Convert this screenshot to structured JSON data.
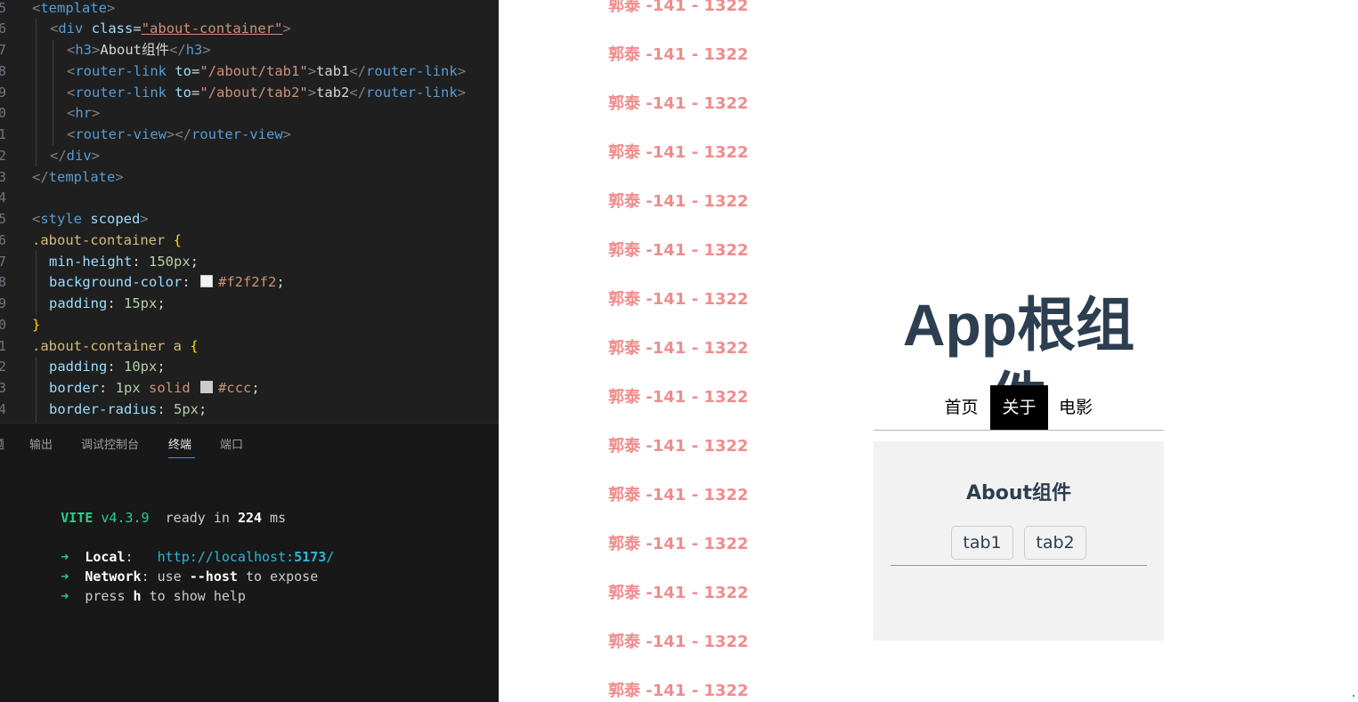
{
  "editor": {
    "lines": [
      {
        "n": "5",
        "tokens": [
          [
            "punct",
            "<"
          ],
          [
            "tag",
            "template"
          ],
          [
            "punct",
            ">"
          ]
        ]
      },
      {
        "n": "6",
        "tokens": [
          [
            "punct",
            "<"
          ],
          [
            "tag",
            "div"
          ],
          [
            "text",
            " "
          ],
          [
            "attr",
            "class"
          ],
          [
            "text",
            "="
          ],
          [
            "str",
            "\"about-container\""
          ],
          [
            "punct",
            ">"
          ]
        ]
      },
      {
        "n": "7",
        "tokens": [
          [
            "punct",
            "<"
          ],
          [
            "tag",
            "h3"
          ],
          [
            "punct",
            ">"
          ],
          [
            "text",
            "About组件"
          ],
          [
            "punct",
            "</"
          ],
          [
            "tag",
            "h3"
          ],
          [
            "punct",
            ">"
          ]
        ]
      },
      {
        "n": "8",
        "tokens": [
          [
            "punct",
            "<"
          ],
          [
            "tag",
            "router-link"
          ],
          [
            "text",
            " "
          ],
          [
            "attr",
            "to"
          ],
          [
            "text",
            "="
          ],
          [
            "str",
            "\"/about/tab1\""
          ],
          [
            "punct",
            ">"
          ],
          [
            "text",
            "tab1"
          ],
          [
            "punct",
            "</"
          ],
          [
            "tag",
            "router-link"
          ],
          [
            "punct",
            ">"
          ]
        ]
      },
      {
        "n": "9",
        "tokens": [
          [
            "punct",
            "<"
          ],
          [
            "tag",
            "router-link"
          ],
          [
            "text",
            " "
          ],
          [
            "attr",
            "to"
          ],
          [
            "text",
            "="
          ],
          [
            "str",
            "\"/about/tab2\""
          ],
          [
            "punct",
            ">"
          ],
          [
            "text",
            "tab2"
          ],
          [
            "punct",
            "</"
          ],
          [
            "tag",
            "router-link"
          ],
          [
            "punct",
            ">"
          ]
        ]
      },
      {
        "n": "0",
        "tokens": [
          [
            "punct",
            "<"
          ],
          [
            "tag",
            "hr"
          ],
          [
            "punct",
            ">"
          ]
        ]
      },
      {
        "n": "1",
        "tokens": [
          [
            "punct",
            "<"
          ],
          [
            "tag",
            "router-view"
          ],
          [
            "punct",
            "></"
          ],
          [
            "tag",
            "router-view"
          ],
          [
            "punct",
            ">"
          ]
        ]
      },
      {
        "n": "2",
        "tokens": [
          [
            "punct",
            "</"
          ],
          [
            "tag",
            "div"
          ],
          [
            "punct",
            ">"
          ]
        ]
      },
      {
        "n": "3",
        "tokens": [
          [
            "punct",
            "</"
          ],
          [
            "tag",
            "template"
          ],
          [
            "punct",
            ">"
          ]
        ]
      },
      {
        "n": "4",
        "tokens": []
      },
      {
        "n": "5",
        "tokens": [
          [
            "punct",
            "<"
          ],
          [
            "tag",
            "style"
          ],
          [
            "text",
            " "
          ],
          [
            "attr",
            "scoped"
          ],
          [
            "punct",
            ">"
          ]
        ]
      },
      {
        "n": "6",
        "tokens": [
          [
            "sel",
            ".about-container"
          ],
          [
            "text",
            " "
          ],
          [
            "brace",
            "{"
          ]
        ]
      },
      {
        "n": "7",
        "tokens": [
          [
            "prop",
            "min-height"
          ],
          [
            "text",
            ": "
          ],
          [
            "num",
            "150px"
          ],
          [
            "text",
            ";"
          ]
        ]
      },
      {
        "n": "8",
        "tokens": [
          [
            "prop",
            "background-color"
          ],
          [
            "text",
            ": "
          ],
          [
            "swatch",
            "#f2f2f2"
          ],
          [
            "val",
            "#f2f2f2"
          ],
          [
            "text",
            ";"
          ]
        ]
      },
      {
        "n": "9",
        "tokens": [
          [
            "prop",
            "padding"
          ],
          [
            "text",
            ": "
          ],
          [
            "num",
            "15px"
          ],
          [
            "text",
            ";"
          ]
        ]
      },
      {
        "n": "0",
        "tokens": [
          [
            "brace",
            "}"
          ]
        ]
      },
      {
        "n": "1",
        "tokens": [
          [
            "sel",
            ".about-container a"
          ],
          [
            "text",
            " "
          ],
          [
            "brace",
            "{"
          ]
        ]
      },
      {
        "n": "2",
        "tokens": [
          [
            "prop",
            "padding"
          ],
          [
            "text",
            ": "
          ],
          [
            "num",
            "10px"
          ],
          [
            "text",
            ";"
          ]
        ]
      },
      {
        "n": "3",
        "tokens": [
          [
            "prop",
            "border"
          ],
          [
            "text",
            ": "
          ],
          [
            "num",
            "1px"
          ],
          [
            "text",
            " "
          ],
          [
            "val",
            "solid"
          ],
          [
            "text",
            " "
          ],
          [
            "swatch",
            "#ccc"
          ],
          [
            "val",
            "#ccc"
          ],
          [
            "text",
            ";"
          ]
        ]
      },
      {
        "n": "4",
        "tokens": [
          [
            "prop",
            "border-radius"
          ],
          [
            "text",
            ": "
          ],
          [
            "num",
            "5px"
          ],
          [
            "text",
            ";"
          ]
        ]
      }
    ]
  },
  "panel": {
    "tabs": [
      {
        "label": "题",
        "active": false
      },
      {
        "label": "输出",
        "active": false
      },
      {
        "label": "调试控制台",
        "active": false
      },
      {
        "label": "终端",
        "active": true
      },
      {
        "label": "端口",
        "active": false
      }
    ],
    "terminal": {
      "vite_name": "VITE",
      "vite_version": "v4.3.9",
      "ready_text": "  ready in ",
      "ready_ms": "224",
      "ready_unit": " ms",
      "arrow": "➜",
      "local_label": "Local",
      "local_url_prefix": "http://localhost:",
      "local_port": "5173",
      "local_url_suffix": "/",
      "network_label": "Network",
      "network_text1": ": use ",
      "network_flag": "--host",
      "network_text2": " to expose",
      "help_text1": "press ",
      "help_key": "h",
      "help_text2": " to show help"
    }
  },
  "watermark": {
    "text": "郭泰 -141 - 1322",
    "color": "#f08c8c"
  },
  "page": {
    "title": "App根组件",
    "nav": [
      {
        "label": "首页",
        "active": false
      },
      {
        "label": "关于",
        "active": true
      },
      {
        "label": "电影",
        "active": false
      }
    ],
    "about": {
      "title": "About组件",
      "links": [
        {
          "label": "tab1"
        },
        {
          "label": "tab2"
        }
      ]
    }
  }
}
